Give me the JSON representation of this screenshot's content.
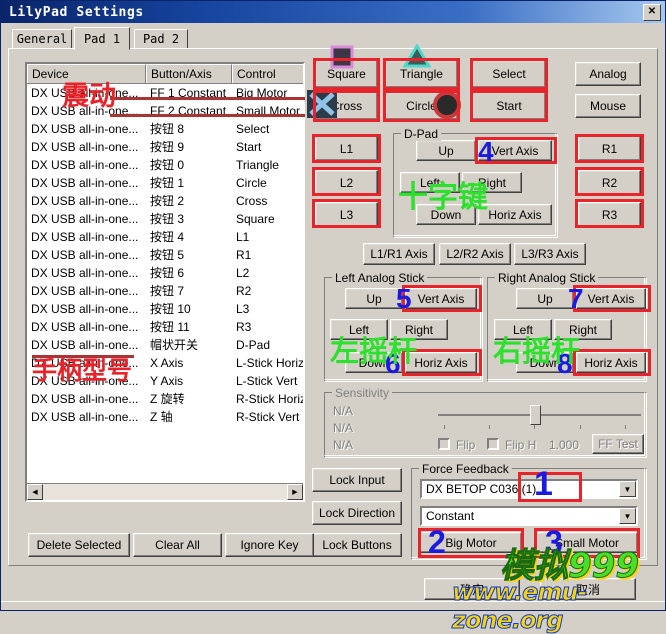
{
  "window": {
    "title": "LilyPad Settings",
    "close_label": "✕"
  },
  "tabs": [
    {
      "label": "General",
      "selected": false
    },
    {
      "label": "Pad 1",
      "selected": true
    },
    {
      "label": "Pad 2",
      "selected": false
    }
  ],
  "binding_list": {
    "columns": [
      "Device",
      "Button/Axis",
      "Control"
    ],
    "rows": [
      {
        "device": "DX USB all-in-one...",
        "button": "FF 1 Constant",
        "control": "Big Motor"
      },
      {
        "device": "DX USB all-in-one...",
        "button": "FF 2 Constant",
        "control": "Small Motor"
      },
      {
        "device": "DX USB all-in-one...",
        "button": "按钮 8",
        "control": "Select"
      },
      {
        "device": "DX USB all-in-one...",
        "button": "按钮 9",
        "control": "Start"
      },
      {
        "device": "DX USB all-in-one...",
        "button": "按钮 0",
        "control": "Triangle"
      },
      {
        "device": "DX USB all-in-one...",
        "button": "按钮 1",
        "control": "Circle"
      },
      {
        "device": "DX USB all-in-one...",
        "button": "按钮 2",
        "control": "Cross"
      },
      {
        "device": "DX USB all-in-one...",
        "button": "按钮 3",
        "control": "Square"
      },
      {
        "device": "DX USB all-in-one...",
        "button": "按钮 4",
        "control": "L1"
      },
      {
        "device": "DX USB all-in-one...",
        "button": "按钮 5",
        "control": "R1"
      },
      {
        "device": "DX USB all-in-one...",
        "button": "按钮 6",
        "control": "L2"
      },
      {
        "device": "DX USB all-in-one...",
        "button": "按钮 7",
        "control": "R2"
      },
      {
        "device": "DX USB all-in-one...",
        "button": "按钮 10",
        "control": "L3"
      },
      {
        "device": "DX USB all-in-one...",
        "button": "按钮 11",
        "control": "R3"
      },
      {
        "device": "DX USB all-in-one...",
        "button": "帽状开关",
        "control": "D-Pad"
      },
      {
        "device": "DX USB all-in-one...",
        "button": "X Axis",
        "control": "L-Stick Horiz"
      },
      {
        "device": "DX USB all-in-one...",
        "button": "Y Axis",
        "control": "L-Stick Vert"
      },
      {
        "device": "DX USB all-in-one...",
        "button": "Z 旋转",
        "control": "R-Stick Horiz"
      },
      {
        "device": "DX USB all-in-one...",
        "button": "Z 轴",
        "control": "R-Stick Vert"
      }
    ]
  },
  "face_buttons": {
    "square": "Square",
    "triangle": "Triangle",
    "cross": "Cross",
    "circle": "Circle",
    "select": "Select",
    "start": "Start"
  },
  "mode_buttons": {
    "analog": "Analog",
    "mouse": "Mouse"
  },
  "shoulder_left": [
    "L1",
    "L2",
    "L3"
  ],
  "shoulder_right": [
    "R1",
    "R2",
    "R3"
  ],
  "dpad": {
    "legend": "D-Pad",
    "up": "Up",
    "vert_axis": "Vert Axis",
    "left": "Left",
    "right": "Right",
    "down": "Down",
    "horiz_axis": "Horiz Axis"
  },
  "axis_buttons": [
    "L1/R1 Axis",
    "L2/R2 Axis",
    "L3/R3 Axis"
  ],
  "left_stick": {
    "legend": "Left Analog Stick",
    "up": "Up",
    "vert_axis": "Vert Axis",
    "left": "Left",
    "right": "Right",
    "down": "Down",
    "horiz_axis": "Horiz Axis"
  },
  "right_stick": {
    "legend": "Right Analog Stick",
    "up": "Up",
    "vert_axis": "Vert Axis",
    "left": "Left",
    "right": "Right",
    "down": "Down",
    "horiz_axis": "Horiz Axis"
  },
  "sensitivity": {
    "legend": "Sensitivity",
    "na1": "N/A",
    "na2": "N/A",
    "na3": "N/A",
    "flip": "Flip",
    "flip_h": "Flip H",
    "value": "1.000",
    "ff_test": "FF Test"
  },
  "lock_buttons": {
    "lock_input": "Lock Input",
    "lock_direction": "Lock Direction",
    "lock_buttons": "Lock Buttons"
  },
  "force_feedback": {
    "legend": "Force Feedback",
    "device": "DX BETOP C036 (1)",
    "effect": "Constant",
    "big_motor": "Big Motor",
    "small_motor": "Small Motor"
  },
  "list_actions": {
    "delete_selected": "Delete Selected",
    "clear_all": "Clear All",
    "ignore_key": "Ignore Key"
  },
  "dialog_buttons": {
    "ok": "确定",
    "cancel": "取消"
  },
  "annotations": {
    "num1": "1",
    "num2": "2",
    "num3": "3",
    "num4": "4",
    "num5": "5",
    "num6": "6",
    "num7": "7",
    "num8": "8",
    "vibration": "震动",
    "pad_model": "手柄型号",
    "dpad_cn": "十字键",
    "left_stick_cn": "左摇杆",
    "right_stick_cn": "右摇杆"
  },
  "watermark": {
    "brand": "模拟999",
    "url": "www.emu-zone.org"
  },
  "colors": {
    "annotation_red": "#e8232a",
    "annotation_blue": "#1a1ae0",
    "annotation_green": "#2ee02e",
    "title_blue": "#0a246a",
    "face_bg": "#d4d0c8"
  }
}
